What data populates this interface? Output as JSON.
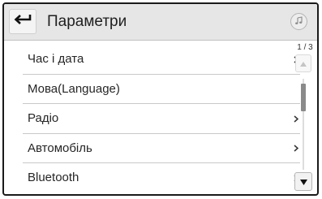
{
  "header": {
    "title": "Параметри",
    "back_icon": "back-arrow-icon",
    "music_icon": "music-note-icon"
  },
  "menu": {
    "items": [
      {
        "label": "Час і дата",
        "has_submenu": true
      },
      {
        "label": "Мова(Language)",
        "has_submenu": false
      },
      {
        "label": "Радіо",
        "has_submenu": true
      },
      {
        "label": "Автомобіль",
        "has_submenu": true
      },
      {
        "label": "Bluetooth",
        "has_submenu": true
      }
    ]
  },
  "scroll": {
    "page_indicator": "1 / 3",
    "up_icon": "triangle-up-icon",
    "down_icon": "triangle-down-icon"
  },
  "colors": {
    "header_bg": "#e6e6e6",
    "frame": "#1a1a1a",
    "divider": "#c9c9c9"
  }
}
